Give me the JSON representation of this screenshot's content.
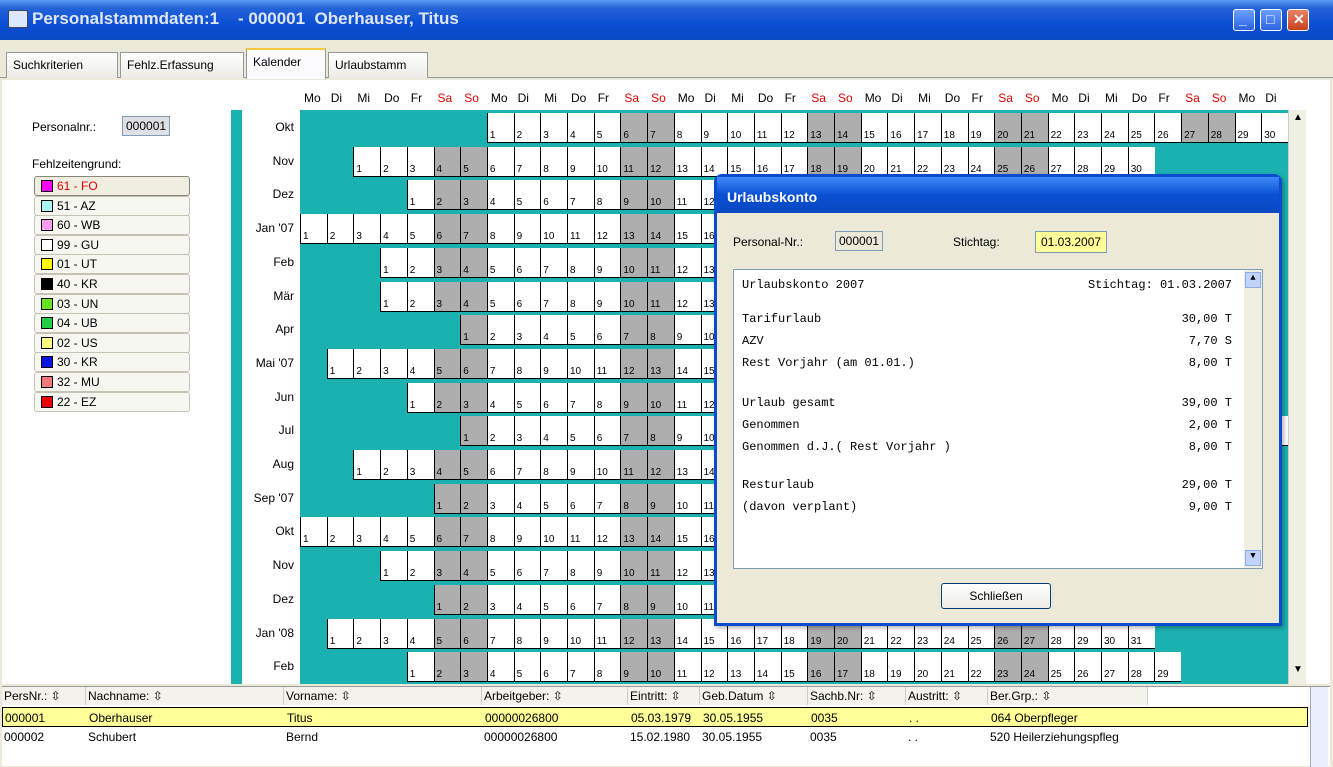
{
  "window": {
    "title": "Personalstammdaten:1",
    "subtitle": "- 000001  Oberhauser, Titus"
  },
  "tabs": [
    "Suchkriterien",
    "Fehlz.Erfassung",
    "Kalender",
    "Urlaubstamm"
  ],
  "weekdays": [
    "Mo",
    "Di",
    "Mi",
    "Do",
    "Fr",
    "Sa",
    "So",
    "Mo",
    "Di",
    "Mi",
    "Do",
    "Fr",
    "Sa",
    "So",
    "Mo",
    "Di",
    "Mi",
    "Do",
    "Fr",
    "Sa",
    "So",
    "Mo",
    "Di",
    "Mi",
    "Do",
    "Fr",
    "Sa",
    "So",
    "Mo",
    "Di",
    "Mi",
    "Do",
    "Fr",
    "Sa",
    "So",
    "Mo",
    "Di"
  ],
  "left": {
    "personal_label": "Personalnr.:",
    "personal_value": "000001",
    "reason_label": "Fehlzeitengrund:"
  },
  "legend": [
    {
      "code": "61 - FO",
      "color": "#ff00ff"
    },
    {
      "code": "51 - AZ",
      "color": "#aaf3f3"
    },
    {
      "code": "60 - WB",
      "color": "#ff9bf0"
    },
    {
      "code": "99 - GU",
      "color": "#ffffff"
    },
    {
      "code": "01 - UT",
      "color": "#ffff00"
    },
    {
      "code": "40 - KR",
      "color": "#000000"
    },
    {
      "code": "03 - UN",
      "color": "#66e61e"
    },
    {
      "code": "04 - UB",
      "color": "#22cc44"
    },
    {
      "code": "02 - US",
      "color": "#ffff80"
    },
    {
      "code": "30 - KR",
      "color": "#0a14e0"
    },
    {
      "code": "32 - MU",
      "color": "#f07a7a"
    },
    {
      "code": "22 - EZ",
      "color": "#ee0000"
    }
  ],
  "months": [
    {
      "label": "Okt",
      "start": 7,
      "days": 31
    },
    {
      "label": "Nov",
      "start": 2,
      "days": 30
    },
    {
      "label": "Dez",
      "start": 4,
      "days": 31
    },
    {
      "label": "Jan '07",
      "start": 0,
      "days": 31
    },
    {
      "label": "Feb",
      "start": 3,
      "days": 28
    },
    {
      "label": "Mär",
      "start": 3,
      "days": 31
    },
    {
      "label": "Apr",
      "start": 6,
      "days": 30
    },
    {
      "label": "Mai '07",
      "start": 1,
      "days": 31
    },
    {
      "label": "Jun",
      "start": 4,
      "days": 30
    },
    {
      "label": "Jul",
      "start": 6,
      "days": 31
    },
    {
      "label": "Aug",
      "start": 2,
      "days": 31
    },
    {
      "label": "Sep '07",
      "start": 5,
      "days": 30
    },
    {
      "label": "Okt",
      "start": 0,
      "days": 31
    },
    {
      "label": "Nov",
      "start": 3,
      "days": 30
    },
    {
      "label": "Dez",
      "start": 5,
      "days": 31
    },
    {
      "label": "Jan '08",
      "start": 1,
      "days": 31
    },
    {
      "label": "Feb",
      "start": 4,
      "days": 29
    }
  ],
  "dialog": {
    "title": "Urlaubskonto",
    "personal_label": "Personal-Nr.:",
    "personal_value": "000001",
    "stichtag_label": "Stichtag:",
    "stichtag_value": "01.03.2007",
    "header_left": "Urlaubskonto 2007",
    "header_right": "Stichtag: 01.03.2007",
    "lines": [
      {
        "label": "Tarifurlaub",
        "value": "30,00 T"
      },
      {
        "label": "AZV",
        "value": "7,70 S"
      },
      {
        "label": "Rest Vorjahr (am 01.01.)",
        "value": "8,00 T"
      },
      {
        "label": "Urlaub gesamt",
        "value": "39,00 T"
      },
      {
        "label": "Genommen",
        "value": "2,00 T"
      },
      {
        "label": "Genommen d.J.( Rest Vorjahr )",
        "value": "8,00 T"
      },
      {
        "label": "Resturlaub",
        "value": "29,00 T"
      },
      {
        "label": "(davon verplant)",
        "value": "9,00 T"
      }
    ],
    "close_label": "Schließen"
  },
  "table": {
    "headers": [
      "PersNr.:",
      "Nachname:",
      "Vorname:",
      "Arbeitgeber:",
      "Eintritt:",
      "Geb.Datum",
      "Sachb.Nr:",
      "Austritt:",
      "Ber.Grp.:"
    ],
    "rows": [
      [
        "000001",
        "Oberhauser",
        "Titus",
        "00000026800",
        "05.03.1979",
        "30.05.1955",
        "0035",
        ". .",
        "064 Oberpfleger"
      ],
      [
        "000002",
        "Schubert",
        "Bernd",
        "00000026800",
        "15.02.1980",
        "30.05.1955",
        "0035",
        ". .",
        "520 Heilerziehungspfleg"
      ]
    ]
  }
}
